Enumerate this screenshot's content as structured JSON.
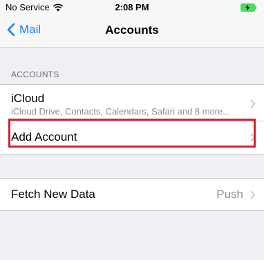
{
  "status_bar": {
    "carrier": "No Service",
    "time": "2:08 PM",
    "icons": [
      "wifi-icon",
      "battery-charging-icon"
    ]
  },
  "nav": {
    "back_label": "Mail",
    "title": "Accounts",
    "back_icon": "chevron-left-icon"
  },
  "accounts_section": {
    "header": "ACCOUNTS",
    "items": [
      {
        "title": "iCloud",
        "subtitle": "iCloud Drive, Contacts, Calendars, Safari and 8 more..."
      },
      {
        "title": "Add Account"
      }
    ]
  },
  "fetch_section": {
    "title": "Fetch New Data",
    "value": "Push"
  },
  "colors": {
    "accent": "#147efb",
    "highlight": "#d6202f",
    "background": "#efeff4"
  }
}
